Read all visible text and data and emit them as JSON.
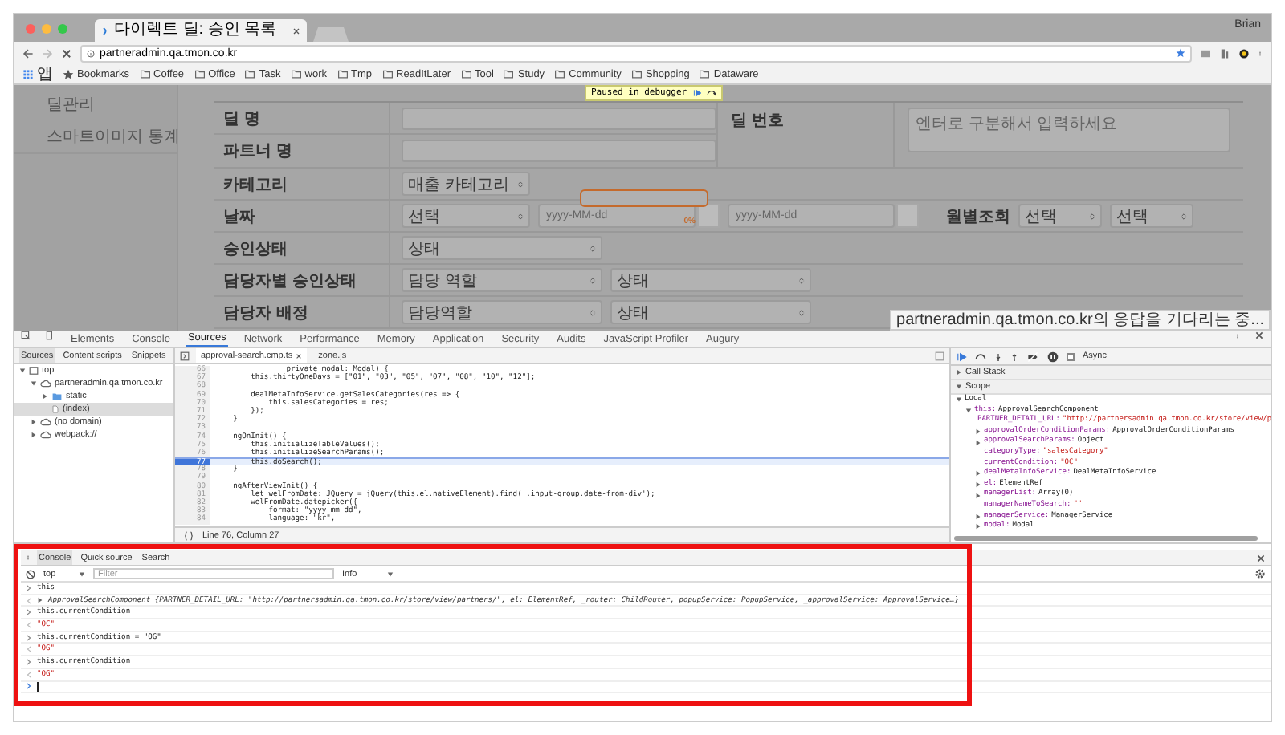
{
  "browser": {
    "tab_title": "다이렉트 딜: 승인 목록",
    "user": "Brian",
    "url": "partneradmin.qa.tmon.co.kr",
    "bookmarks": [
      {
        "label": "앱",
        "kind": "apps"
      },
      {
        "label": "Bookmarks",
        "kind": "star"
      },
      {
        "label": "Coffee",
        "kind": "folder"
      },
      {
        "label": "Office",
        "kind": "folder"
      },
      {
        "label": "Task",
        "kind": "folder"
      },
      {
        "label": "work",
        "kind": "folder"
      },
      {
        "label": "Tmp",
        "kind": "folder"
      },
      {
        "label": "ReadItLater",
        "kind": "folder"
      },
      {
        "label": "Tool",
        "kind": "folder"
      },
      {
        "label": "Study",
        "kind": "folder"
      },
      {
        "label": "Community",
        "kind": "folder"
      },
      {
        "label": "Shopping",
        "kind": "folder"
      },
      {
        "label": "Dataware",
        "kind": "folder"
      }
    ]
  },
  "page": {
    "debugger_banner": "Paused in debugger",
    "sidebar": [
      "딜관리",
      "스마트이미지 통계"
    ],
    "top_rows": [
      {
        "label": "딜 명"
      },
      {
        "label": "파트너 명"
      }
    ],
    "deal_number": {
      "label": "딜 번호",
      "placeholder": "엔터로 구분해서 입력하세요"
    },
    "rows": [
      {
        "label": "카테고리",
        "fields": [
          {
            "kind": "short_select",
            "value": "매출 카테고리"
          }
        ]
      },
      {
        "label": "날짜",
        "fields": [
          {
            "kind": "short_select",
            "value": "선택"
          },
          {
            "kind": "date",
            "placeholder": "yyyy-MM-dd",
            "progress": {
              "level": 0,
              "label": "0%"
            }
          },
          {
            "kind": "calendar_button"
          },
          {
            "kind": "date",
            "placeholder": "yyyy-MM-dd"
          },
          {
            "kind": "calendar_button"
          },
          {
            "kind": "label",
            "text": "월별조회"
          },
          {
            "kind": "small_select",
            "value": "선택"
          },
          {
            "kind": "small_select",
            "value": "선택"
          }
        ]
      },
      {
        "label": "승인상태",
        "fields": [
          {
            "kind": "select",
            "value": "상태"
          }
        ]
      },
      {
        "label": "담당자별 승인상태",
        "fields": [
          {
            "kind": "select",
            "value": "담당 역할"
          },
          {
            "kind": "select",
            "value": "상태"
          }
        ]
      },
      {
        "label": "담당자 배정",
        "fields": [
          {
            "kind": "select",
            "value": "담당역할"
          },
          {
            "kind": "select",
            "value": "상태"
          }
        ]
      }
    ],
    "status_tooltip": "partneradmin.qa.tmon.co.kr의 응답을 기다리는 중..."
  },
  "devtools": {
    "tabs": [
      {
        "label": "Elements",
        "selected": false
      },
      {
        "label": "Console",
        "selected": false
      },
      {
        "label": "Sources",
        "selected": true
      },
      {
        "label": "Network",
        "selected": false
      },
      {
        "label": "Performance",
        "selected": false
      },
      {
        "label": "Memory",
        "selected": false
      },
      {
        "label": "Application",
        "selected": false
      },
      {
        "label": "Security",
        "selected": false
      },
      {
        "label": "Audits",
        "selected": false
      },
      {
        "label": "JavaScript Profiler",
        "selected": false
      },
      {
        "label": "Augury",
        "selected": false
      }
    ],
    "navigator_tabs": [
      {
        "label": "Sources",
        "selected": true
      },
      {
        "label": "Content scripts",
        "selected": false
      },
      {
        "label": "Snippets",
        "selected": false
      }
    ],
    "tree": [
      {
        "label": "top",
        "kind": "frame",
        "expanded": true,
        "selected": false,
        "children": [
          {
            "label": "partneradmin.qa.tmon.co.kr",
            "kind": "cloud",
            "expanded": true,
            "selected": false,
            "children": [
              {
                "label": "static",
                "kind": "folder",
                "expanded": false,
                "selected": false
              },
              {
                "label": "(index)",
                "kind": "file",
                "selected": true
              }
            ]
          },
          {
            "label": "(no domain)",
            "kind": "cloud",
            "expanded": false,
            "selected": false
          },
          {
            "label": "webpack://",
            "kind": "cloud",
            "expanded": false,
            "selected": false
          }
        ]
      }
    ],
    "editor_tabs": [
      {
        "label": "approval-search.cmp.ts",
        "selected": true
      },
      {
        "label": "zone.js",
        "selected": false
      }
    ],
    "code": [
      {
        "number": "66",
        "text": "                private modal: Modal) {",
        "highlighted": false
      },
      {
        "number": "67",
        "text": "        this.thirtyOneDays = [\"01\", \"03\", \"05\", \"07\", \"08\", \"10\", \"12\"];",
        "highlighted": false
      },
      {
        "number": "68",
        "highlighted": false
      },
      {
        "number": "69",
        "text": "        dealMetaInfoService.getSalesCategories(res => {",
        "highlighted": false
      },
      {
        "number": "70",
        "text": "            this.salesCategories = res;",
        "highlighted": false
      },
      {
        "number": "71",
        "text": "        });",
        "highlighted": false
      },
      {
        "number": "72",
        "text": "    }",
        "highlighted": false
      },
      {
        "number": "73",
        "highlighted": false
      },
      {
        "number": "74",
        "text": "    ngOnInit() {",
        "highlighted": false
      },
      {
        "number": "75",
        "text": "        this.initializeTableValues();",
        "highlighted": false
      },
      {
        "number": "76",
        "text": "        this.initializeSearchParams();",
        "highlighted": false
      },
      {
        "number": "77",
        "text": "        this.doSearch();",
        "highlighted": true
      },
      {
        "number": "78",
        "text": "    }",
        "highlighted": false
      },
      {
        "number": "79",
        "highlighted": false
      },
      {
        "number": "80",
        "text": "    ngAfterViewInit() {",
        "highlighted": false
      },
      {
        "number": "81",
        "text": "        let welFromDate: JQuery = jQuery(this.el.nativeElement).find('.input-group.date-from-div');",
        "highlighted": false
      },
      {
        "number": "82",
        "text": "        welFromDate.datepicker({",
        "highlighted": false
      },
      {
        "number": "83",
        "text": "            format: \"yyyy-mm-dd\",",
        "highlighted": false
      },
      {
        "number": "84",
        "text": "            language: \"kr\",",
        "highlighted": false
      }
    ],
    "cursor_position": "Line 76, Column 27",
    "async_label": "Async",
    "async_checked": false,
    "sections": [
      {
        "label": "Call Stack",
        "expanded": false
      },
      {
        "label": "Scope",
        "expanded": true
      }
    ],
    "scope": [
      {
        "key": "Local",
        "expanded": true,
        "children": [
          {
            "key": "this:",
            "value": "ApprovalSearchComponent",
            "expanded": true,
            "children": [
              {
                "key": "PARTNER_DETAIL_URL:",
                "value": "\"http://partnersadmin.qa.tmon.co.kr/store/view/p",
                "kind": "string"
              },
              {
                "key": "approvalOrderConditionParams:",
                "value": "ApprovalOrderConditionParams",
                "kind": "object",
                "expanded": false
              },
              {
                "key": "approvalSearchParams:",
                "value": "Object",
                "kind": "object",
                "expanded": false
              },
              {
                "key": "categoryType:",
                "value": "\"salesCategory\"",
                "kind": "string"
              },
              {
                "key": "currentCondition:",
                "value": "\"OC\"",
                "kind": "string"
              },
              {
                "key": "dealMetaInfoService:",
                "value": "DealMetaInfoService",
                "kind": "object",
                "expanded": false
              },
              {
                "key": "el:",
                "value": "ElementRef",
                "kind": "object",
                "expanded": false
              },
              {
                "key": "managerList:",
                "value": "Array(0)",
                "kind": "object",
                "expanded": false
              },
              {
                "key": "managerNameToSearch:",
                "value": "\"\"",
                "kind": "string"
              },
              {
                "key": "managerService:",
                "value": "ManagerService",
                "kind": "object",
                "expanded": false
              },
              {
                "key": "modal:",
                "value": "Modal",
                "kind": "object",
                "expanded": false
              }
            ]
          }
        ]
      }
    ],
    "drawer_tabs": [
      {
        "label": "Console",
        "selected": true
      },
      {
        "label": "Quick source",
        "selected": false
      },
      {
        "label": "Search",
        "selected": false
      }
    ],
    "context": "top",
    "filter_placeholder": "Filter",
    "level": "Info",
    "console": [
      {
        "kind": "input",
        "text": "this"
      },
      {
        "kind": "object",
        "text": "ApprovalSearchComponent {PARTNER_DETAIL_URL: \"http://partnersadmin.qa.tmon.co.kr/store/view/partners/\", el: ElementRef, _router: ChildRouter, popupService: PopupService, _approvalService: ApprovalService…}"
      },
      {
        "kind": "input",
        "text": "this.currentCondition"
      },
      {
        "kind": "string",
        "text": "\"OC\""
      },
      {
        "kind": "input",
        "text": "this.currentCondition = \"OG\""
      },
      {
        "kind": "string",
        "text": "\"OG\""
      },
      {
        "kind": "input",
        "text": "this.currentCondition"
      },
      {
        "kind": "string",
        "text": "\"OG\""
      },
      {
        "kind": "prompt"
      }
    ]
  }
}
